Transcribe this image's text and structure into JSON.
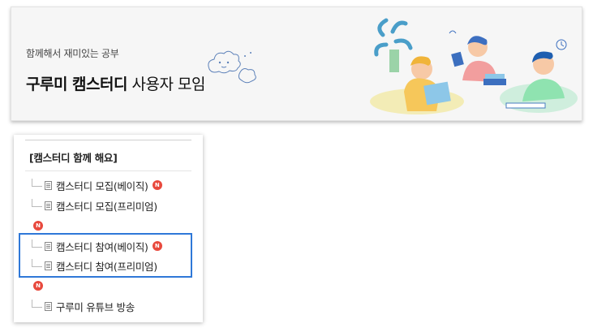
{
  "banner": {
    "subtitle": "함께해서 재미있는 공부",
    "title_bold": "구루미 캠스터디",
    "title_light": " 사용자 모임"
  },
  "menu": {
    "header": "[캠스터디 함께 해요]",
    "items": [
      {
        "label": "캠스터디 모집(베이직)",
        "badge": "N"
      },
      {
        "label": "캠스터디 모집(프리미엄)",
        "badge": ""
      },
      {
        "label": "캠스터디 참여(베이직)",
        "badge": "N"
      },
      {
        "label": "캠스터디 참여(프리미엄)",
        "badge": ""
      },
      {
        "label": "구루미 유튜브 방송",
        "badge": ""
      }
    ],
    "wrapped_badges": [
      "N",
      "N"
    ]
  },
  "colors": {
    "badge": "#e8493d",
    "highlight_border": "#2f78d8"
  },
  "icons": [
    "doc-icon",
    "tree-branch-icon",
    "new-badge"
  ]
}
